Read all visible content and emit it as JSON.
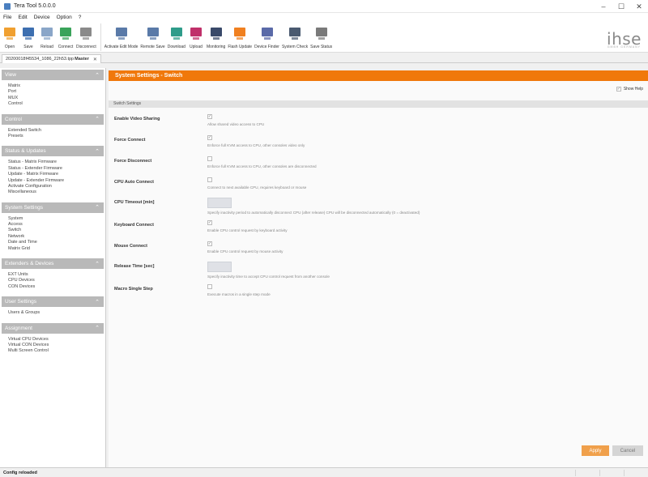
{
  "window": {
    "title": "Tera Tool 5.0.0.0",
    "min": "–",
    "max": "☐",
    "close": "✕"
  },
  "menu": [
    "File",
    "Edit",
    "Device",
    "Option",
    "?"
  ],
  "toolbar": [
    {
      "label": "Open",
      "icon": "open-folder-icon",
      "color": "#f0a030"
    },
    {
      "label": "Save",
      "icon": "save-disk-icon",
      "color": "#3d6fb0"
    },
    {
      "label": "Reload",
      "icon": "reload-icon",
      "color": "#8aa6c8"
    },
    {
      "label": "Connect",
      "icon": "connect-icon",
      "color": "#3aa35a"
    },
    {
      "label": "Disconnect",
      "icon": "disconnect-icon",
      "color": "#8a8a8a"
    },
    {
      "label": "Activate Edit Mode",
      "icon": "edit-mode-icon",
      "color": "#5a7aa8"
    },
    {
      "label": "Remote Save",
      "icon": "remote-save-icon",
      "color": "#5a7aa8"
    },
    {
      "label": "Download",
      "icon": "download-icon",
      "color": "#2e9c8a"
    },
    {
      "label": "Upload",
      "icon": "upload-icon",
      "color": "#c0306a"
    },
    {
      "label": "Monitoring",
      "icon": "monitor-icon",
      "color": "#3a4a6a"
    },
    {
      "label": "Flash Update",
      "icon": "flash-update-icon",
      "color": "#f08020"
    },
    {
      "label": "Device Finder",
      "icon": "device-finder-icon",
      "color": "#5a6aa8"
    },
    {
      "label": "System Check",
      "icon": "system-check-icon",
      "color": "#4a5a70"
    },
    {
      "label": "Save Status",
      "icon": "save-status-icon",
      "color": "#7a7a7a"
    }
  ],
  "logo": {
    "text": "ihse",
    "sub": "GMBH GERMANY"
  },
  "tab": {
    "prefix": "20200018f45534_1086_22h53.tpp",
    "bold": "Master",
    "close": "✕"
  },
  "sidebar": [
    {
      "title": "View",
      "items": [
        "Matrix",
        "Port",
        "MUX",
        "Control"
      ]
    },
    {
      "title": "Control",
      "items": [
        "Extended Switch",
        "Presets"
      ]
    },
    {
      "title": "Status & Updates",
      "items": [
        "Status - Matrix Firmware",
        "Status - Extender Firmware",
        "Update - Matrix Firmware",
        "Update - Extender Firmware",
        "Activate Configuration",
        "Miscellaneous"
      ]
    },
    {
      "title": "System Settings",
      "items": [
        "System",
        "Access",
        "Switch",
        "Network",
        "Date and Time",
        "Matrix Grid"
      ]
    },
    {
      "title": "Extenders & Devices",
      "items": [
        "EXT Units",
        "CPU Devices",
        "CON Devices"
      ]
    },
    {
      "title": "User Settings",
      "items": [
        "Users & Groups"
      ]
    },
    {
      "title": "Assignment",
      "items": [
        "Virtual CPU Devices",
        "Virtual CON Devices",
        "Multi Screen Control"
      ]
    }
  ],
  "main": {
    "heading": "System Settings - Switch",
    "show_help": "Show Help",
    "subheading": "Switch Settings",
    "rows": [
      {
        "label": "Enable Video Sharing",
        "type": "check",
        "checked": true,
        "help": "Allow shared video access to CPU"
      },
      {
        "label": "Force Connect",
        "type": "check",
        "checked": true,
        "help": "Enforce full KVM access to CPU, other consoles video only"
      },
      {
        "label": "Force Disconnect",
        "type": "check",
        "checked": false,
        "help": "Enforce full KVM access to CPU, other consoles are disconnected"
      },
      {
        "label": "CPU Auto Connect",
        "type": "check",
        "checked": false,
        "help": "Connect to next available CPU, requires keyboard or mouse"
      },
      {
        "label": "CPU Timeout [min]",
        "type": "number",
        "help": "Specify inactivity period to automatically disconnect CPU (after release) CPU will be disconnected automatically (0 = deactivated)"
      },
      {
        "label": "Keyboard Connect",
        "type": "check",
        "checked": true,
        "help": "Enable CPU control request by keyboard activity"
      },
      {
        "label": "Mouse Connect",
        "type": "check",
        "checked": true,
        "help": "Enable CPU control request by mouse activity"
      },
      {
        "label": "Release Time [sec]",
        "type": "number",
        "help": "Specify inactivity time to accept CPU control request from another console"
      },
      {
        "label": "Macro Single Step",
        "type": "check",
        "checked": false,
        "help": "Execute macros in a single step mode"
      }
    ],
    "apply": "Apply",
    "cancel": "Cancel"
  },
  "status": "Config reloaded"
}
